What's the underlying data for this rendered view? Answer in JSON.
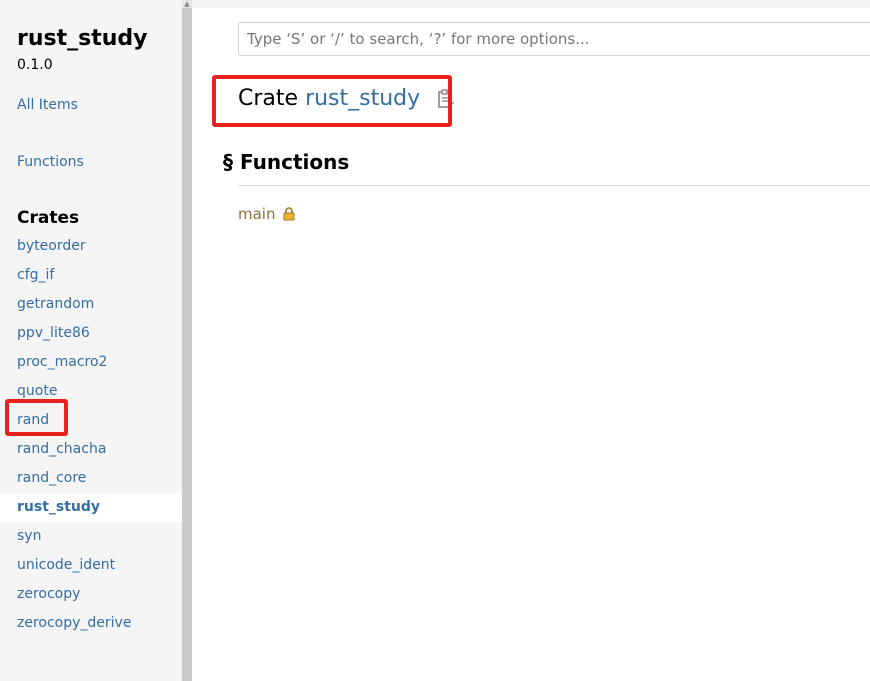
{
  "sidebar": {
    "crate_title": "rust_study",
    "version": "0.1.0",
    "all_items_label": "All Items",
    "functions_label": "Functions",
    "crates_heading": "Crates",
    "crates": [
      "byteorder",
      "cfg_if",
      "getrandom",
      "ppv_lite86",
      "proc_macro2",
      "quote",
      "rand",
      "rand_chacha",
      "rand_core",
      "rust_study",
      "syn",
      "unicode_ident",
      "zerocopy",
      "zerocopy_derive"
    ],
    "current_crate": "rust_study"
  },
  "search": {
    "placeholder": "Type ‘S’ or ‘/’ to search, ‘?’ for more options..."
  },
  "main": {
    "title_prefix": "Crate",
    "crate_name": "rust_study",
    "section_marker": "§",
    "section_title": "Functions",
    "functions": [
      {
        "name": "main",
        "icon": "lock-icon"
      }
    ]
  },
  "colors": {
    "link": "#356da4",
    "function": "#8b6d40",
    "highlight_box": "#e8211c",
    "sidebar_bg": "#f5f5f5"
  },
  "icons": {
    "copy": "clipboard-copy-icon",
    "private": "lock-icon"
  }
}
